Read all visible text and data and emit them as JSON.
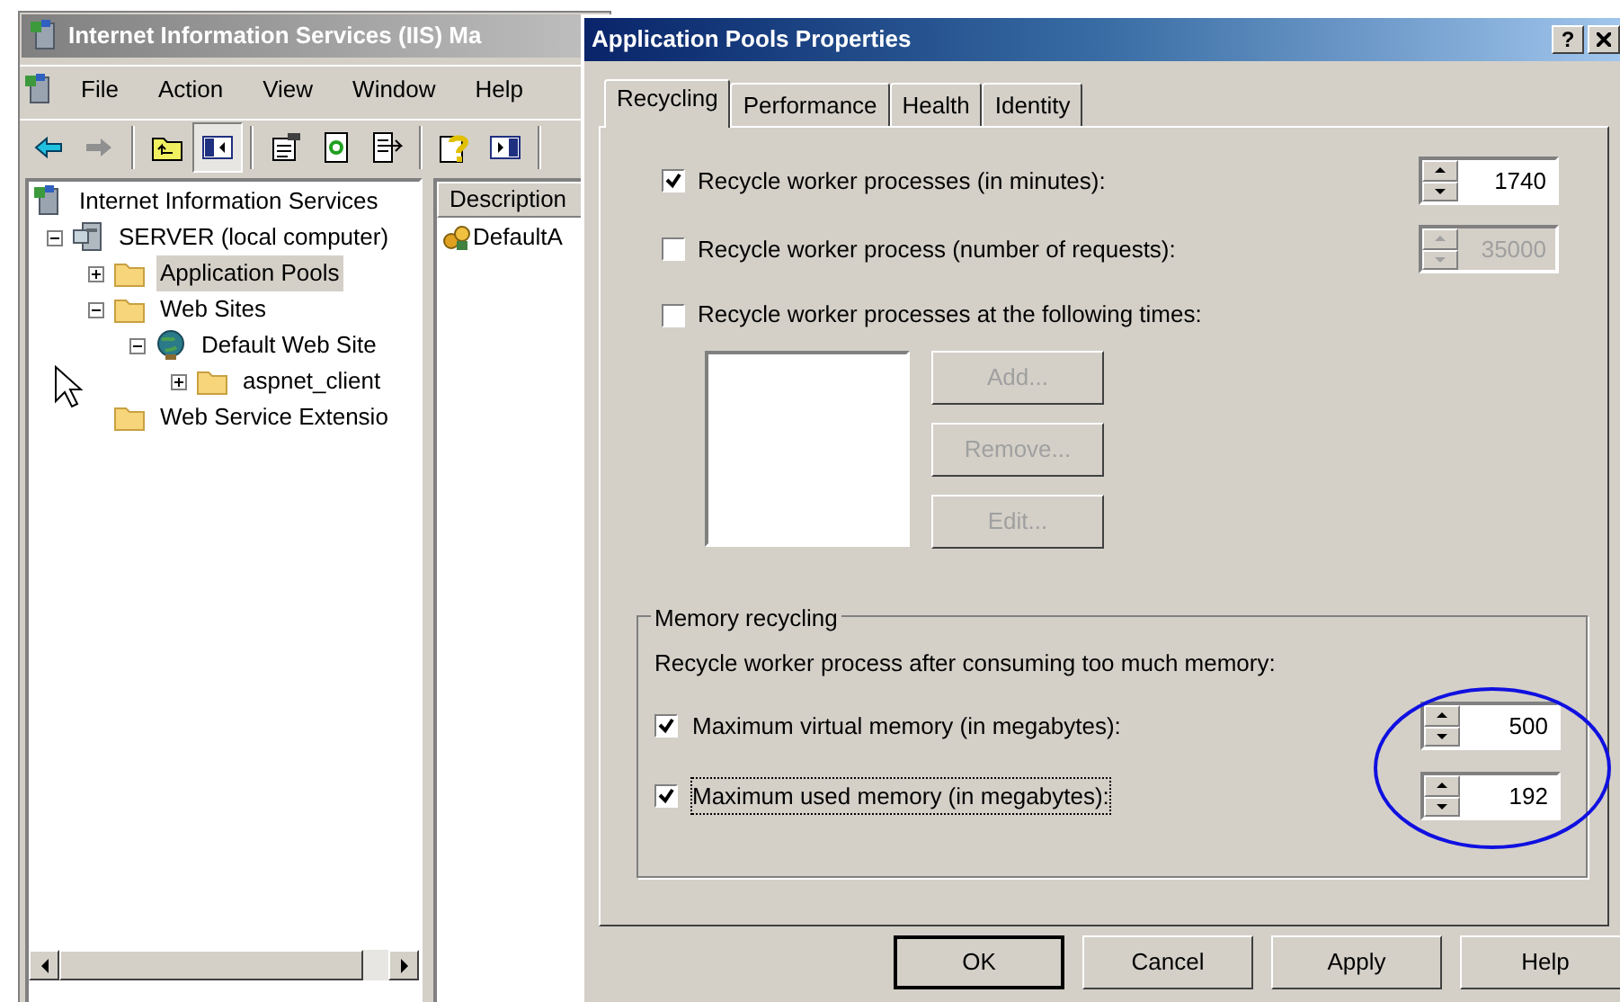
{
  "main_window": {
    "title": "Internet Information Services (IIS) Ma",
    "menu": [
      "File",
      "Action",
      "View",
      "Window",
      "Help"
    ],
    "toolbar": [
      {
        "kind": "back",
        "pressed": false
      },
      {
        "kind": "forward",
        "pressed": false
      },
      {
        "kind": "separator"
      },
      {
        "kind": "up",
        "pressed": false
      },
      {
        "kind": "tree",
        "pressed": true
      },
      {
        "kind": "separator"
      },
      {
        "kind": "properties",
        "pressed": false
      },
      {
        "kind": "refresh",
        "pressed": false
      },
      {
        "kind": "export",
        "pressed": false
      },
      {
        "kind": "separator"
      },
      {
        "kind": "help",
        "pressed": false
      },
      {
        "kind": "action",
        "pressed": false
      },
      {
        "kind": "separator"
      }
    ],
    "tree": [
      {
        "label": "Internet Information Services",
        "kind": "iis",
        "selected": false,
        "children": [
          {
            "label": "SERVER (local computer)",
            "kind": "server",
            "selected": false,
            "expanded": true,
            "children": [
              {
                "label": "Application Pools",
                "kind": "folder",
                "selected": true,
                "expanded": false
              },
              {
                "label": "Web Sites",
                "kind": "folder",
                "selected": false,
                "expanded": true,
                "children": [
                  {
                    "label": "Default Web Site",
                    "kind": "globe",
                    "selected": false,
                    "expanded": true,
                    "children": [
                      {
                        "label": "aspnet_client",
                        "kind": "folder",
                        "selected": false,
                        "expanded": false
                      }
                    ]
                  }
                ]
              },
              {
                "label": "Web Service Extensio",
                "kind": "folder",
                "selected": false
              }
            ]
          }
        ]
      }
    ],
    "list": {
      "columns": [
        "Description"
      ],
      "rows": [
        "DefaultA"
      ]
    }
  },
  "dialog": {
    "title": "Application Pools Properties",
    "help_button": "?",
    "tabs": [
      {
        "label": "Recycling",
        "selected": true
      },
      {
        "label": "Performance",
        "selected": false
      },
      {
        "label": "Health",
        "selected": false
      },
      {
        "label": "Identity",
        "selected": false
      }
    ],
    "recycling": [
      {
        "label": "Recycle worker processes (in minutes):",
        "checked": true,
        "value": "1740",
        "disabled": false
      },
      {
        "label": "Recycle worker process (number of requests):",
        "checked": false,
        "value": "35000",
        "disabled": true
      }
    ],
    "schedule": {
      "label": "Recycle worker processes at the following times:",
      "checked": false,
      "buttons": [
        {
          "label": "Add...",
          "disabled": true
        },
        {
          "label": "Remove...",
          "disabled": true
        },
        {
          "label": "Edit...",
          "disabled": true
        }
      ]
    },
    "memory": {
      "title": "Memory recycling",
      "description": "Recycle worker process after consuming too much memory:",
      "rows": [
        {
          "label": "Maximum virtual memory (in megabytes):",
          "checked": true,
          "value": "500",
          "focused": false
        },
        {
          "label": "Maximum used memory (in megabytes):",
          "checked": true,
          "value": "192",
          "focused": true
        }
      ]
    },
    "highlight": {
      "kind": "ellipse"
    },
    "buttons": [
      {
        "label": "OK",
        "default": true
      },
      {
        "label": "Cancel",
        "default": false
      },
      {
        "label": "Apply",
        "default": false
      },
      {
        "label": "Help",
        "default": false
      }
    ]
  }
}
